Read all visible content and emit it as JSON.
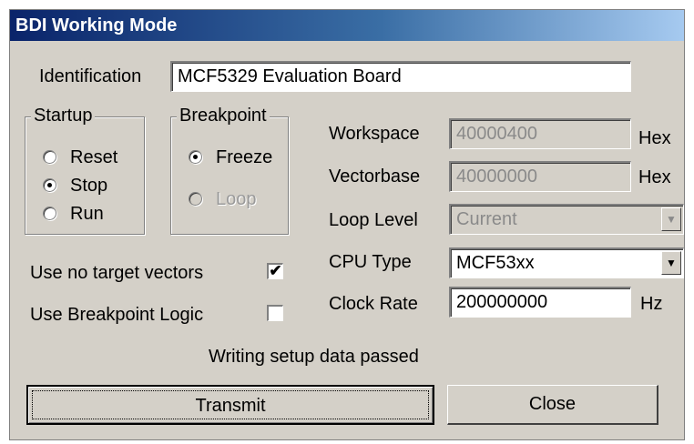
{
  "window": {
    "title": "BDI Working Mode"
  },
  "identification": {
    "label": "Identification",
    "value": "MCF5329 Evaluation Board"
  },
  "startup": {
    "label": "Startup",
    "options": [
      {
        "label": "Reset",
        "selected": false
      },
      {
        "label": "Stop",
        "selected": true
      },
      {
        "label": "Run",
        "selected": false
      }
    ]
  },
  "breakpoint": {
    "label": "Breakpoint",
    "options": [
      {
        "label": "Freeze",
        "selected": true,
        "enabled": true
      },
      {
        "label": "Loop",
        "selected": false,
        "enabled": false
      }
    ]
  },
  "workspace": {
    "label": "Workspace",
    "value": "40000400",
    "unit": "Hex"
  },
  "vectorbase": {
    "label": "Vectorbase",
    "value": "40000000",
    "unit": "Hex"
  },
  "loop_level": {
    "label": "Loop Level",
    "value": "Current"
  },
  "cpu_type": {
    "label": "CPU Type",
    "value": "MCF53xx"
  },
  "clock_rate": {
    "label": "Clock Rate",
    "value": "200000000",
    "unit": "Hz"
  },
  "options": {
    "no_target_vectors": {
      "label": "Use no target vectors",
      "checked": true,
      "mark": "✔"
    },
    "breakpoint_logic": {
      "label": "Use Breakpoint Logic",
      "checked": false,
      "mark": ""
    }
  },
  "status": "Writing setup data passed",
  "buttons": {
    "transmit": "Transmit",
    "close": "Close"
  },
  "icons": {
    "dropdown": "▼"
  }
}
